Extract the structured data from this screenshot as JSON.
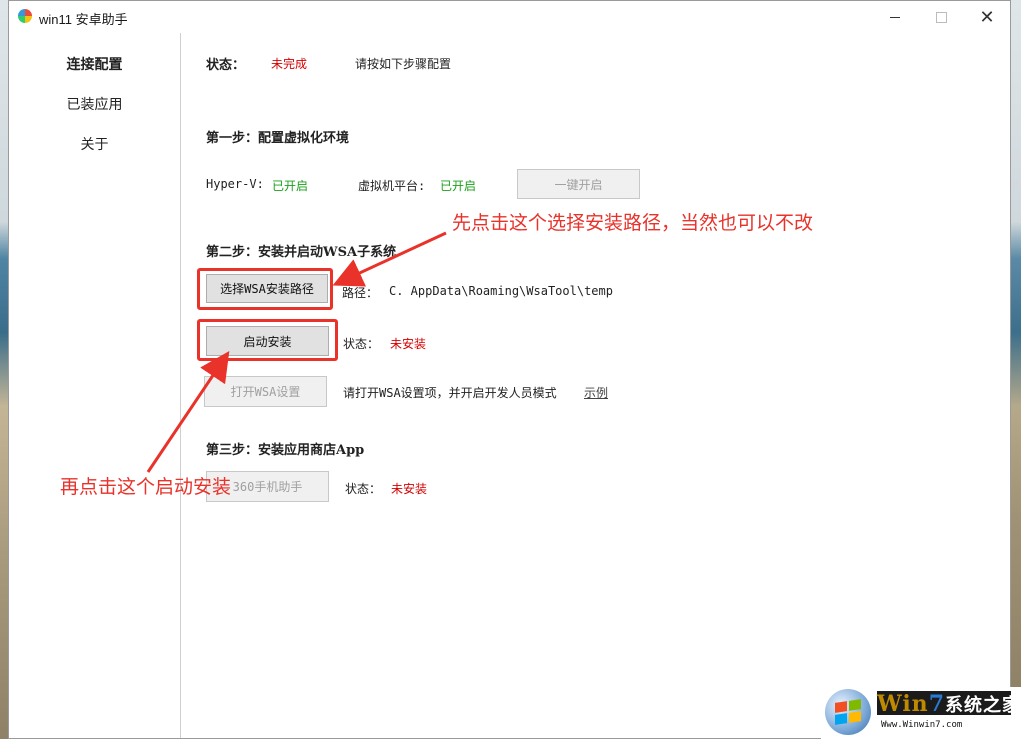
{
  "window": {
    "title": "win11 安卓助手"
  },
  "sidebar": {
    "items": [
      {
        "label": "连接配置",
        "active": true
      },
      {
        "label": "已装应用",
        "active": false
      },
      {
        "label": "关于",
        "active": false
      }
    ]
  },
  "status": {
    "label": "状态：",
    "value": "未完成",
    "hint": "请按如下步骤配置"
  },
  "step1": {
    "heading": "第一步：配置虚拟化环境",
    "hyperv_label": "Hyper-V:",
    "hyperv_value": "已开启",
    "vmp_label": "虚拟机平台:",
    "vmp_value": "已开启",
    "enable_button": "一键开启"
  },
  "step2": {
    "heading": "第二步：安装并启动WSA子系统",
    "choose_path_button": "选择WSA安装路径",
    "path_label": "路径：",
    "path_value": "C.             AppData\\Roaming\\WsaTool\\temp",
    "start_install_button": "启动安装",
    "install_status_label": "状态：",
    "install_status_value": "未安装",
    "open_settings_button": "打开WSA设置",
    "settings_hint": "请打开WSA设置项，并开启开发人员模式",
    "example_link": "示例"
  },
  "step3": {
    "heading": "第三步：安装应用商店App",
    "button": "360手机助手",
    "status_label": "状态：",
    "status_value": "未安装"
  },
  "annotations": {
    "first": "先点击这个选择安装路径，当然也可以不改",
    "second": "再点击这个启动安装"
  },
  "watermark": {
    "text_a": "Win",
    "text_b": "7",
    "text_c": "系统之家",
    "url": "Www.Winwin7.com"
  },
  "colors": {
    "status_red": "#d40000",
    "status_green": "#1aa11a",
    "annotation_red": "#e8322a"
  }
}
